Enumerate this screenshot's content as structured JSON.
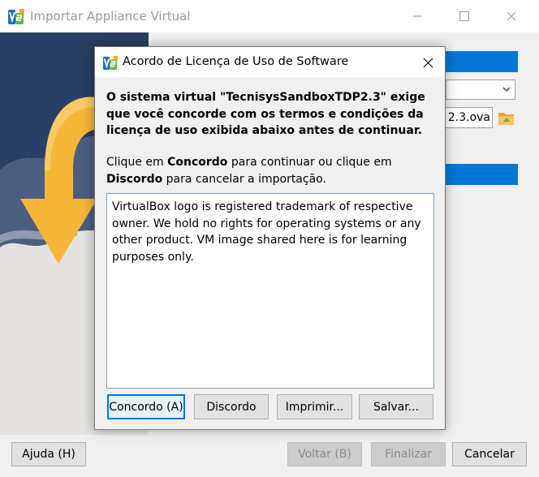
{
  "main_window": {
    "title": "Importar Appliance Virtual",
    "file_field_value": "2.3.ova",
    "footer": {
      "help_label": "Ajuda (H)",
      "back_label": "Voltar (B)",
      "finish_label": "Finalizar",
      "cancel_label": "Cancelar"
    }
  },
  "dialog": {
    "title": "Acordo de Licença de Uso de Software",
    "heading": "O sistema virtual \"TecnisysSandboxTDP2.3\" exige que você concorde com os termos e condições da licença de uso exibida abaixo antes de continuar.",
    "instructions": {
      "part1": "Clique em ",
      "agree_word": "Concordo",
      "part2": " para continuar ou clique em ",
      "disagree_word": "Discordo",
      "part3": " para cancelar a importação."
    },
    "license_text": "VirtualBox logo is registered trademark of respective owner. We hold no rights for operating systems or any other product. VM image shared here is for learning purposes only.",
    "buttons": {
      "agree": "Concordo (A)",
      "disagree": "Discordo",
      "print": "Imprimir...",
      "save": "Salvar..."
    }
  },
  "colors": {
    "accent": "#0078d7",
    "arrow_orange": "#f5b63a",
    "art_dark_blue": "#2a3f66"
  }
}
